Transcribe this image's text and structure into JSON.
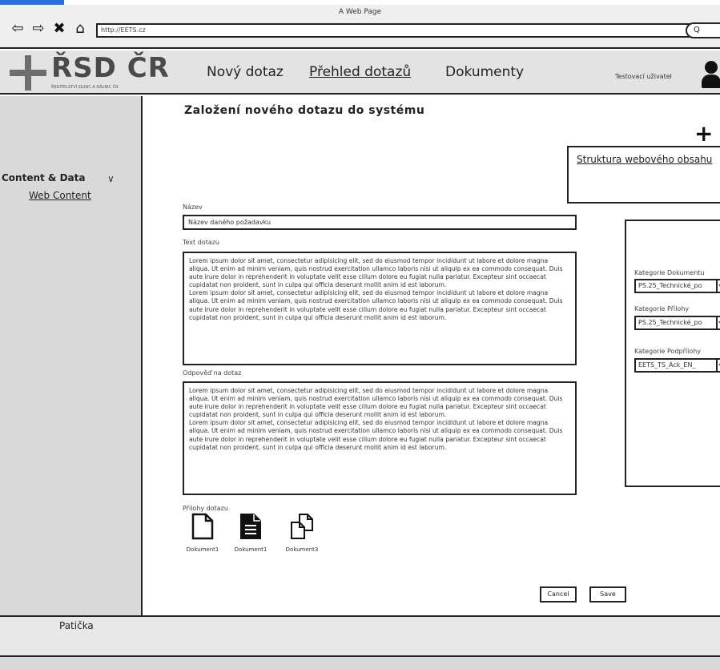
{
  "browser": {
    "window_title": "A Web Page",
    "url": "http://EETS.cz",
    "search_label": "Q"
  },
  "header": {
    "logo_text": "ŘSD ČR",
    "logo_subtitle": "ŘEDITELSTVÍ SILNIC A DÁLNIC ČR",
    "nav": [
      {
        "label": "Nový dotaz",
        "active": false
      },
      {
        "label": "Přehled dotazů",
        "active": true
      },
      {
        "label": "Dokumenty",
        "active": false
      }
    ],
    "user_name": "Testovací uživatel"
  },
  "sidebar": {
    "group_label": "Content & Data",
    "group_chevron": "∨",
    "items": [
      {
        "label": "Web Content"
      }
    ]
  },
  "main": {
    "title": "Založení nového dotazu do systému",
    "add_symbol": "+",
    "structure_label": "Struktura webového obsahu",
    "name_label": "Název",
    "name_value": "Název daného požadavku",
    "question_label": "Text dotazu",
    "question_text": [
      "Lorem ipsum dolor sit amet, consectetur adipisicing elit, sed do eiusmod tempor incididunt ut labore et dolore magna aliqua. Ut enim ad minim veniam, quis nostrud exercitation ullamco laboris nisi ut aliquip ex ea commodo consequat. Duis aute irure dolor in reprehenderit in voluptate velit esse cillum dolore eu fugiat nulla pariatur. Excepteur sint occaecat cupidatat non proident, sunt in culpa qui officia deserunt mollit anim id est laborum.",
      "Lorem ipsum dolor sit amet, consectetur adipisicing elit, sed do eiusmod tempor incididunt ut labore et dolore magna aliqua. Ut enim ad minim veniam, quis nostrud exercitation ullamco laboris nisi ut aliquip ex ea commodo consequat. Duis aute irure dolor in reprehenderit in voluptate velit esse cillum dolore eu fugiat nulla pariatur. Excepteur sint occaecat cupidatat non proident, sunt in culpa qui officia deserunt mollit anim id est laborum."
    ],
    "answer_label": "Odpověď na dotaz",
    "answer_text": [
      "Lorem ipsum dolor sit amet, consectetur adipisicing elit, sed do eiusmod tempor incididunt ut labore et dolore magna aliqua. Ut enim ad minim veniam, quis nostrud exercitation ullamco laboris nisi ut aliquip ex ea commodo consequat. Duis aute irure dolor in reprehenderit in voluptate velit esse cillum dolore eu fugiat nulla pariatur. Excepteur sint occaecat cupidatat non proident, sunt in culpa qui officia deserunt mollit anim id est laborum.",
      "Lorem ipsum dolor sit amet, consectetur adipisicing elit, sed do eiusmod tempor incididunt ut labore et dolore magna aliqua. Ut enim ad minim veniam, quis nostrud exercitation ullamco laboris nisi ut aliquip ex ea commodo consequat. Duis aute irure dolor in reprehenderit in voluptate velit esse cillum dolore eu fugiat nulla pariatur. Excepteur sint occaecat cupidatat non proident, sunt in culpa qui officia deserunt mollit anim id est laborum."
    ],
    "attachments_label": "Přílohy dotazu",
    "attachments": [
      {
        "name": "Dokument1",
        "icon": "file-outline-icon"
      },
      {
        "name": "Dokument1",
        "icon": "file-text-icon"
      },
      {
        "name": "Dokument3",
        "icon": "files-copy-icon"
      }
    ],
    "cancel_label": "Cancel",
    "save_label": "Save"
  },
  "right_panel": {
    "doc_category_label": "Kategorie Dokumentu",
    "doc_category_value": "PS.25_Technické_po",
    "attachment_category_label": "Kategorie Přílohy",
    "attachment_category_value": "PS.25_Technické_po",
    "subattachment_category_label": "Kategorie Podpřílohy",
    "subattachment_category_value": "EETS_TS_Ack_EN_"
  },
  "footer": {
    "label": "Patička"
  }
}
